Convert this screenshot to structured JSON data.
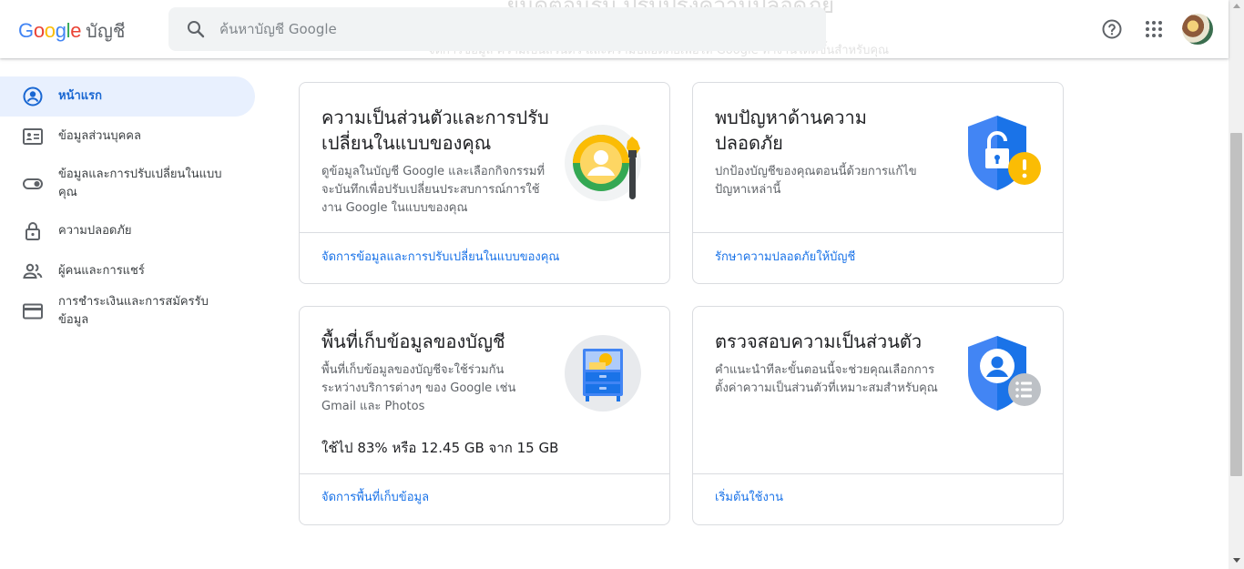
{
  "header": {
    "logo_word": "Google",
    "product": "บัญชี",
    "background_heading": "ยินดีต้อนรับ ปรับปรุงความปลอดภัย",
    "background_sub": "จัดการข้อมูล ความเป็นส่วนตัว และความปลอดภัยเพื่อให้ Google ทำงานได้ดีขึ้นสำหรับคุณ",
    "search_placeholder": "ค้นหาบัญชี Google",
    "help_icon": "help-circle-icon",
    "apps_icon": "apps-grid-icon"
  },
  "colors": {
    "accent": "#1a73e8",
    "active_bg": "#e8f0fe",
    "active_text": "#1967d2",
    "border": "#dadce0",
    "warning": "#fbbc04",
    "google_blue": "#4285f4",
    "google_red": "#ea4335",
    "google_yellow": "#fbbc05",
    "google_green": "#34a853"
  },
  "sidebar": {
    "items": [
      {
        "label": "หน้าแรก",
        "icon": "account-circle-icon",
        "active": true
      },
      {
        "label": "ข้อมูลส่วนบุคคล",
        "icon": "id-card-icon"
      },
      {
        "label": "ข้อมูลและการปรับเปลี่ยนในแบบคุณ",
        "icon": "toggle-icon"
      },
      {
        "label": "ความปลอดภัย",
        "icon": "lock-icon"
      },
      {
        "label": "ผู้คนและการแชร์",
        "icon": "people-icon"
      },
      {
        "label": "การชำระเงินและการสมัครรับข้อมูล",
        "icon": "credit-card-icon"
      }
    ]
  },
  "cards": {
    "privacy": {
      "title": "ความเป็นส่วนตัวและการปรับเปลี่ยนในแบบของคุณ",
      "description": "ดูข้อมูลในบัญชี Google และเลือกกิจกรรมที่จะบันทึกเพื่อปรับเปลี่ยนประสบการณ์การใช้งาน Google ในแบบของคุณ",
      "link": "จัดการข้อมูลและการปรับเปลี่ยนในแบบของคุณ",
      "icon": "personalization-illustration-icon"
    },
    "security": {
      "title": "พบปัญหาด้านความปลอดภัย",
      "description": "ปกป้องบัญชีของคุณตอนนี้ด้วยการแก้ไขปัญหาเหล่านี้",
      "link": "รักษาความปลอดภัยให้บัญชี",
      "icon": "shield-lock-warning-icon"
    },
    "storage": {
      "title": "พื้นที่เก็บข้อมูลของบัญชี",
      "description": "พื้นที่เก็บข้อมูลของบัญชีจะใช้ร่วมกันระหว่างบริการต่างๆ ของ Google เช่น Gmail และ Photos",
      "usage": "ใช้ไป 83% หรือ 12.45 GB จาก 15 GB",
      "usage_percent": 83,
      "link": "จัดการพื้นที่เก็บข้อมูล",
      "icon": "storage-cabinet-icon"
    },
    "checkup": {
      "title": "ตรวจสอบความเป็นส่วนตัว",
      "description": "คำแนะนำทีละขั้นตอนนี้จะช่วยคุณเลือกการตั้งค่าความเป็นส่วนตัวที่เหมาะสมสำหรับคุณ",
      "link": "เริ่มต้นใช้งาน",
      "icon": "shield-person-list-icon"
    }
  }
}
